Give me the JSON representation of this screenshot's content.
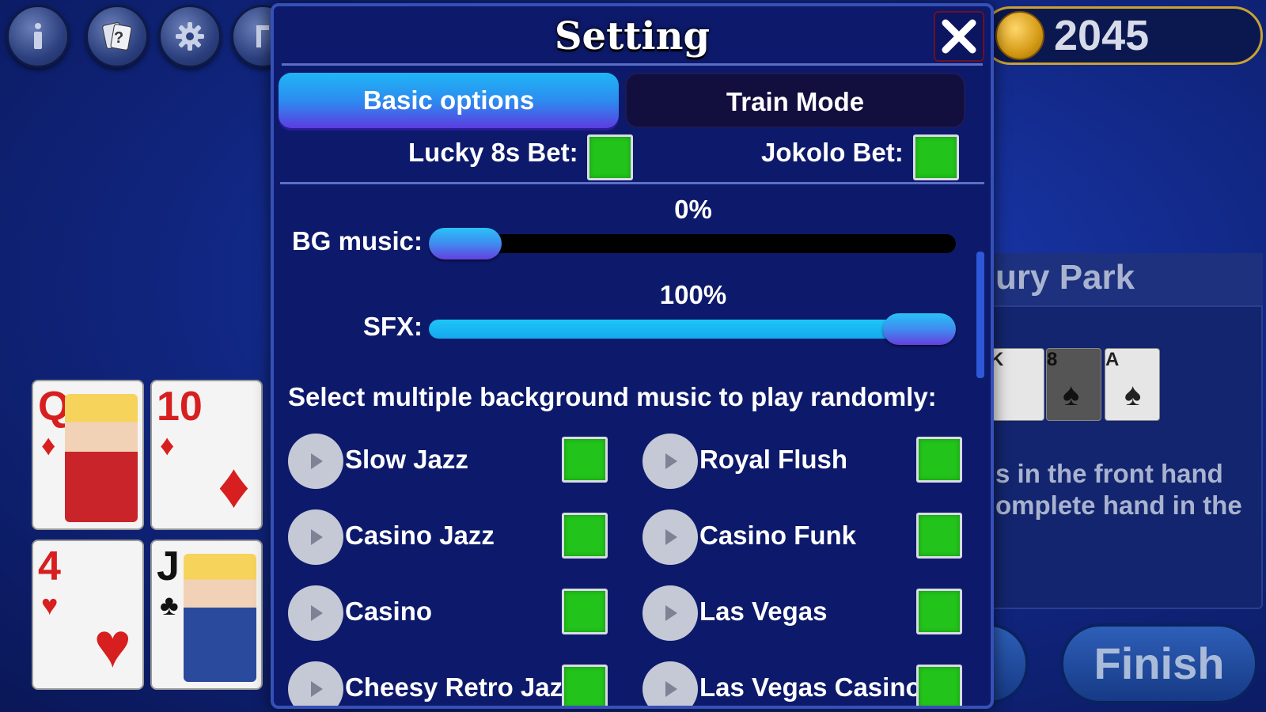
{
  "hud": {
    "coin_balance": "2045",
    "buttons": [
      {
        "name": "info-button",
        "icon": "info-icon"
      },
      {
        "name": "help-cards-button",
        "icon": "cards-question-icon"
      },
      {
        "name": "settings-button",
        "icon": "gear-icon"
      },
      {
        "name": "extra-button",
        "icon": "letter-icon"
      }
    ]
  },
  "background": {
    "panel_title": "ury Park",
    "panel_text_line1": "s in the front hand",
    "panel_text_line2": "omplete hand in the",
    "mini_cards": [
      "K",
      "8",
      "A"
    ],
    "finish_label": "Finish",
    "player_cards": [
      {
        "rank": "Q",
        "suit": "♦",
        "color": "red"
      },
      {
        "rank": "10",
        "suit": "♦",
        "color": "red"
      },
      {
        "rank": "4",
        "suit": "♥",
        "color": "red"
      },
      {
        "rank": "J",
        "suit": "♣",
        "color": "black"
      }
    ]
  },
  "modal": {
    "title": "Setting",
    "close_icon": "close-icon",
    "tabs": {
      "basic": "Basic options",
      "train": "Train Mode",
      "active": "basic"
    },
    "bets": {
      "lucky_label": "Lucky 8s Bet:",
      "lucky_checked": true,
      "jokolo_label": "Jokolo Bet:",
      "jokolo_checked": true
    },
    "bg_music": {
      "label": "BG music:",
      "percent_text": "0%",
      "value": 0
    },
    "sfx": {
      "label": "SFX:",
      "percent_text": "100%",
      "value": 100
    },
    "select_title": "Select multiple background music to play randomly:",
    "tracks": [
      {
        "name": "Slow Jazz",
        "checked": true
      },
      {
        "name": "Royal Flush",
        "checked": true
      },
      {
        "name": "Casino Jazz",
        "checked": true
      },
      {
        "name": "Casino Funk",
        "checked": true
      },
      {
        "name": "Casino",
        "checked": true
      },
      {
        "name": "Las Vegas",
        "checked": true
      },
      {
        "name": "Cheesy Retro Jazz",
        "checked": true
      },
      {
        "name": "Las Vegas Casino",
        "checked": true
      }
    ]
  },
  "colors": {
    "accent_cyan": "#1ec6f7",
    "accent_purple": "#6540df",
    "check_green": "#22c31a",
    "modal_bg": "#0d1a6b"
  }
}
